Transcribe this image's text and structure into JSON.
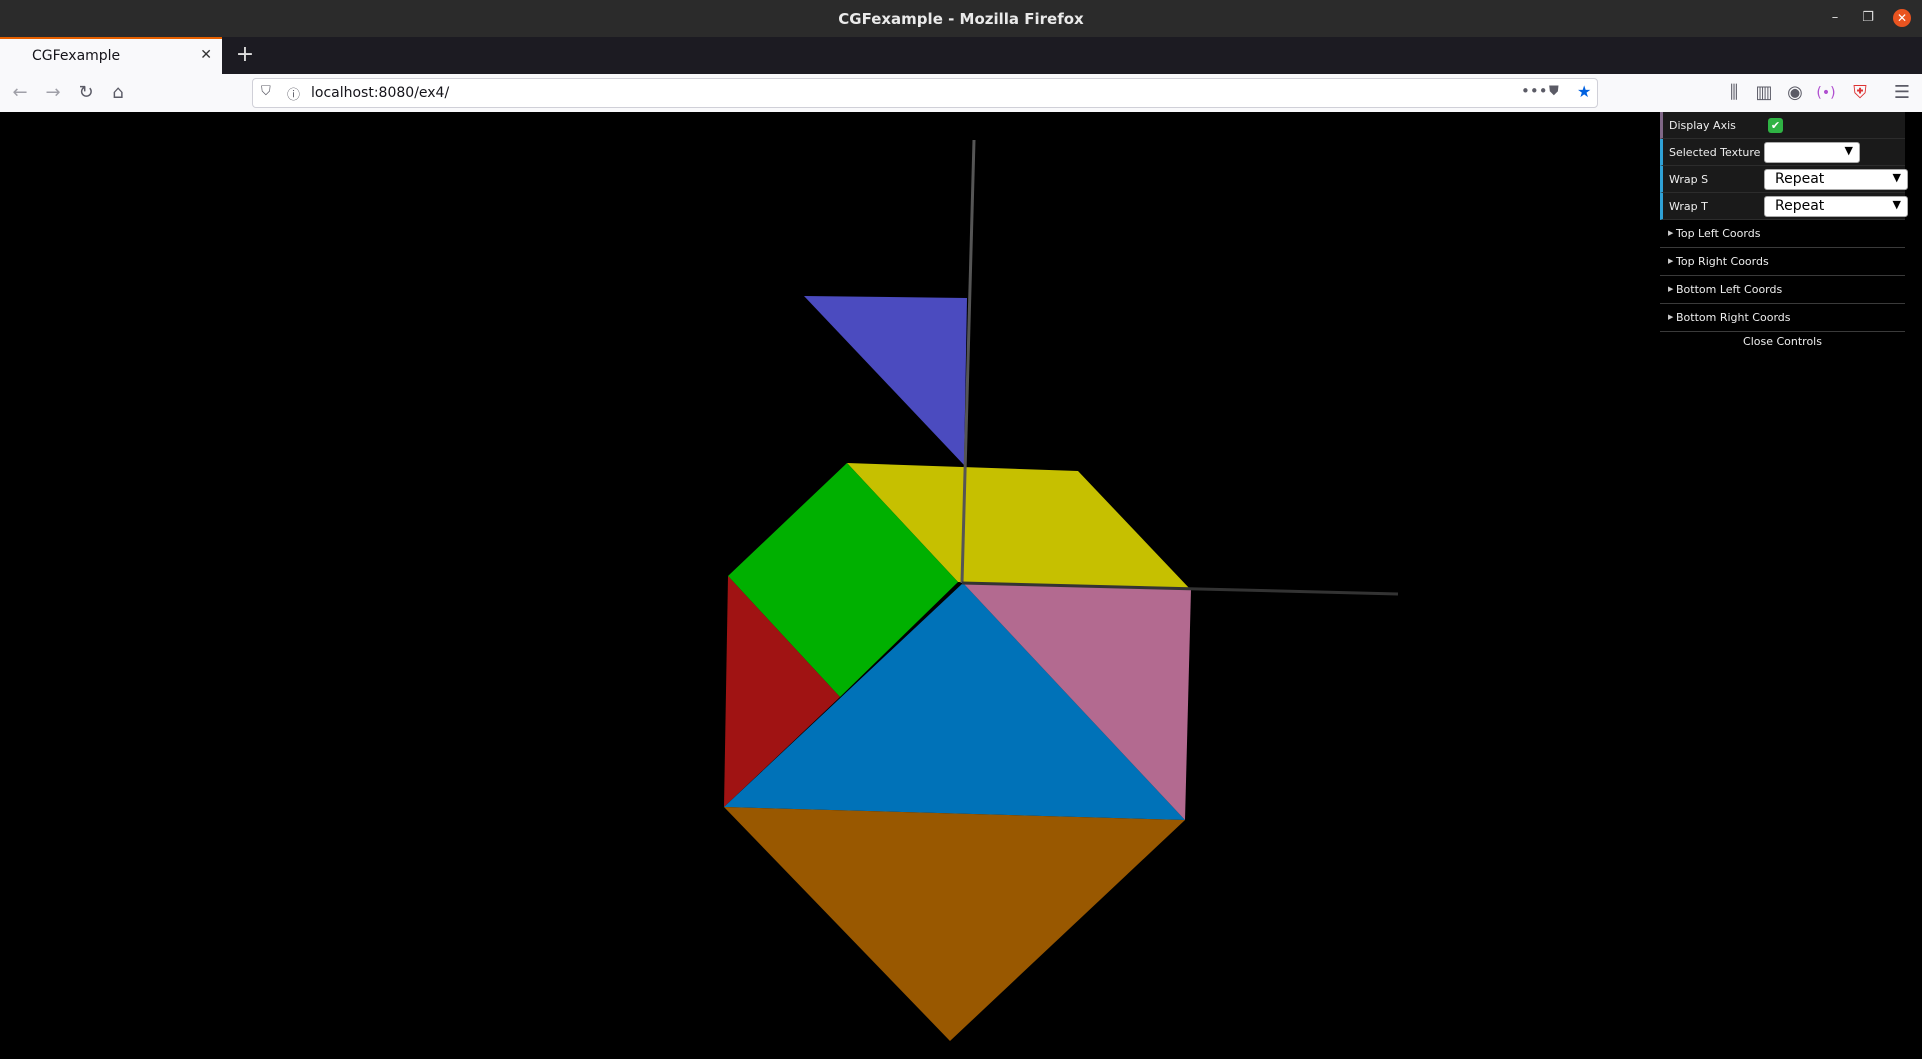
{
  "window": {
    "title": "CGFexample - Mozilla Firefox"
  },
  "tabs": [
    {
      "title": "CGFexample"
    }
  ],
  "toolbar": {
    "url": "localhost:8080/ex4/"
  },
  "gui": {
    "display_axis_label": "Display Axis",
    "display_axis_checked": true,
    "selected_texture_label": "Selected Texture",
    "selected_texture_value": "",
    "wrap_s_label": "Wrap S",
    "wrap_s_value": "Repeat",
    "wrap_t_label": "Wrap T",
    "wrap_t_value": "Repeat",
    "folders": [
      "Top Left Coords",
      "Top Right Coords",
      "Bottom Left Coords",
      "Bottom Right Coords"
    ],
    "close_label": "Close Controls"
  },
  "colors": {
    "purple": "#4b4bbf",
    "yellow": "#c6c000",
    "green": "#00b000",
    "red": "#a01313",
    "blue": "#0072b8",
    "pink": "#b36a90",
    "orange": "#995800",
    "accent": "#e66000"
  }
}
